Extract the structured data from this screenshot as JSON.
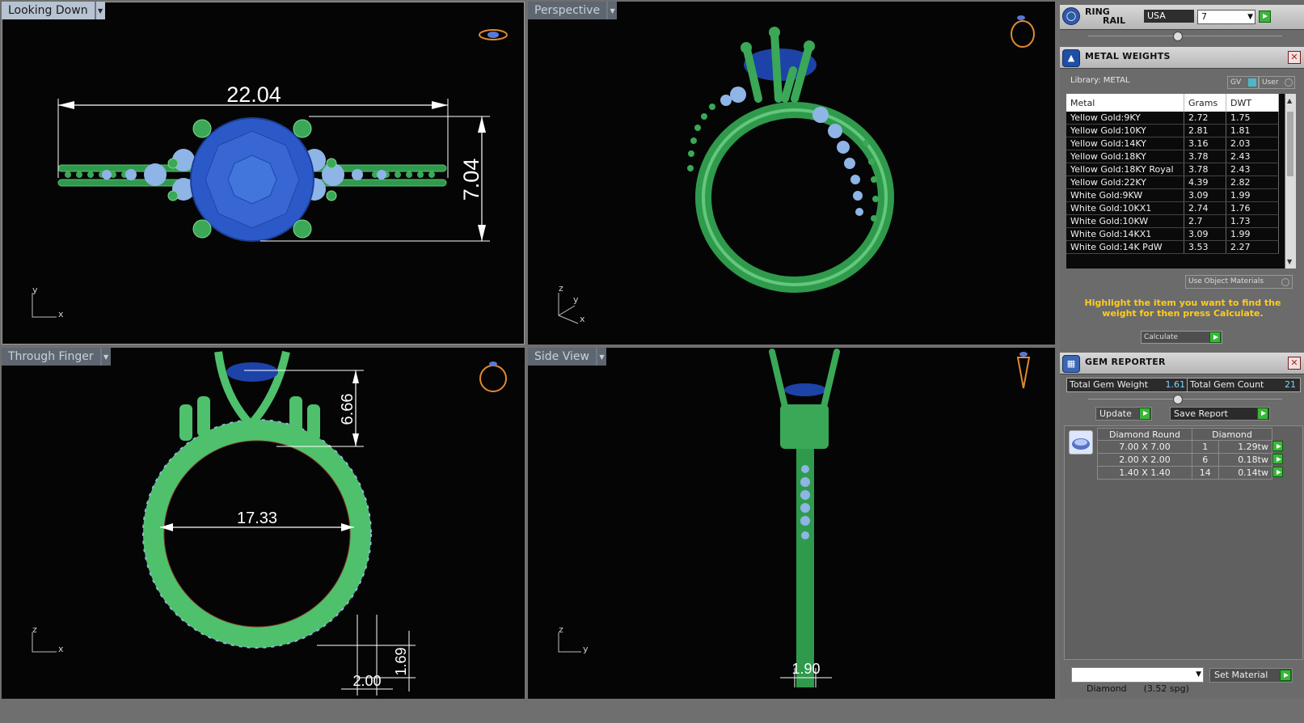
{
  "viewports": {
    "top_left": {
      "name": "Looking Down",
      "dims": [
        "22.04",
        "7.04"
      ],
      "axis": [
        "y",
        "x"
      ]
    },
    "top_right": {
      "name": "Perspective",
      "axis": [
        "z",
        "y",
        "x"
      ]
    },
    "bottom_left": {
      "name": "Through Finger",
      "dims": [
        "6.66",
        "17.33",
        "1.69",
        "2.00"
      ],
      "axis": [
        "z",
        "x"
      ]
    },
    "bottom_right": {
      "name": "Side View",
      "dims": [
        "1.90"
      ],
      "axis": [
        "z",
        "y"
      ]
    }
  },
  "ring_rail": {
    "title_line1": "RING",
    "title_line2": "RAIL",
    "region": "USA",
    "size": "7"
  },
  "metal_weights": {
    "title": "METAL WEIGHTS",
    "library_label": "Library: METAL",
    "gv_label": "GV",
    "user_label": "User",
    "columns": [
      "Metal",
      "Grams",
      "DWT"
    ],
    "rows": [
      [
        "Yellow Gold:9KY",
        "2.72",
        "1.75"
      ],
      [
        "Yellow Gold:10KY",
        "2.81",
        "1.81"
      ],
      [
        "Yellow Gold:14KY",
        "3.16",
        "2.03"
      ],
      [
        "Yellow Gold:18KY",
        "3.78",
        "2.43"
      ],
      [
        "Yellow Gold:18KY Royal",
        "3.78",
        "2.43"
      ],
      [
        "Yellow Gold:22KY",
        "4.39",
        "2.82"
      ],
      [
        "White Gold:9KW",
        "3.09",
        "1.99"
      ],
      [
        "White Gold:10KX1",
        "2.74",
        "1.76"
      ],
      [
        "White Gold:10KW",
        "2.7",
        "1.73"
      ],
      [
        "White Gold:14KX1",
        "3.09",
        "1.99"
      ],
      [
        "White Gold:14K PdW",
        "3.53",
        "2.27"
      ]
    ],
    "use_object_materials": "Use Object Materials",
    "instruction": "Highlight the item you want to find the weight for then press Calculate.",
    "calculate_label": "Calculate"
  },
  "gem_reporter": {
    "title": "GEM REPORTER",
    "total_weight_label": "Total Gem Weight",
    "total_weight_value": "1.61",
    "total_count_label": "Total Gem Count",
    "total_count_value": "21",
    "update_label": "Update",
    "save_report_label": "Save Report",
    "table_headers": [
      "Diamond Round",
      "Diamond"
    ],
    "rows": [
      [
        "7.00 X 7.00",
        "1",
        "1.29tw"
      ],
      [
        "2.00 X 2.00",
        "6",
        "0.18tw"
      ],
      [
        "1.40 X 1.40",
        "14",
        "0.14tw"
      ]
    ],
    "material_select": "Diamond      (3.52 spg)",
    "set_material_label": "Set Material"
  }
}
